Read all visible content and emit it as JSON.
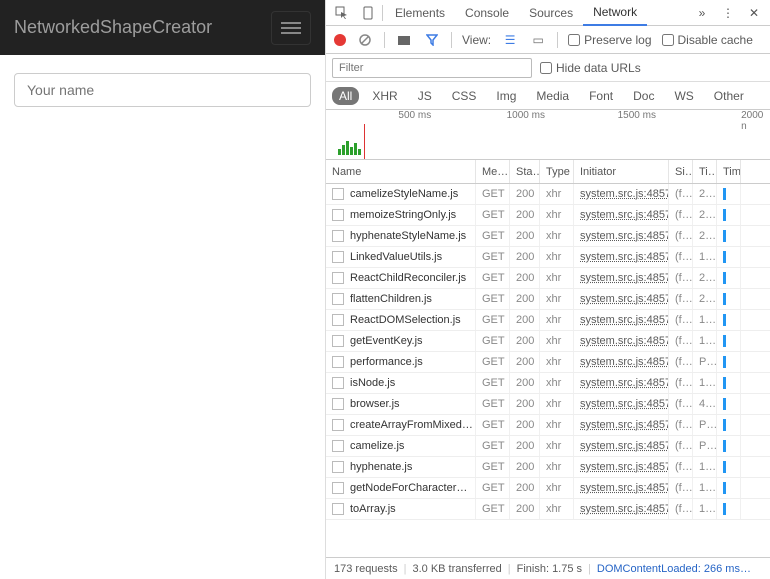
{
  "app": {
    "brand": "NetworkedShapeCreator",
    "name_placeholder": "Your name"
  },
  "devtools": {
    "panels": [
      "Elements",
      "Console",
      "Sources",
      "Network"
    ],
    "active_panel": "Network",
    "toolbar": {
      "view_label": "View:",
      "preserve_log": "Preserve log",
      "disable_cache": "Disable cache"
    },
    "filter": {
      "placeholder": "Filter",
      "hide_data_urls": "Hide data URLs"
    },
    "types": [
      "All",
      "XHR",
      "JS",
      "CSS",
      "Img",
      "Media",
      "Font",
      "Doc",
      "WS",
      "Other"
    ],
    "active_type": "All",
    "timeline_ticks": [
      {
        "label": "500 ms",
        "pos": 20
      },
      {
        "label": "1000 ms",
        "pos": 45
      },
      {
        "label": "1500 ms",
        "pos": 70
      },
      {
        "label": "2000 n",
        "pos": 96
      }
    ],
    "columns": [
      "Name",
      "Me…",
      "Sta…",
      "Type",
      "Initiator",
      "Si…",
      "Ti…",
      "Tim"
    ],
    "rows": [
      {
        "name": "camelizeStyleName.js",
        "method": "GET",
        "status": "200",
        "type": "xhr",
        "initiator": "system.src.js:4857",
        "size": "(f…",
        "time": "2…"
      },
      {
        "name": "memoizeStringOnly.js",
        "method": "GET",
        "status": "200",
        "type": "xhr",
        "initiator": "system.src.js:4857",
        "size": "(f…",
        "time": "2…"
      },
      {
        "name": "hyphenateStyleName.js",
        "method": "GET",
        "status": "200",
        "type": "xhr",
        "initiator": "system.src.js:4857",
        "size": "(f…",
        "time": "2…"
      },
      {
        "name": "LinkedValueUtils.js",
        "method": "GET",
        "status": "200",
        "type": "xhr",
        "initiator": "system.src.js:4857",
        "size": "(f…",
        "time": "1…"
      },
      {
        "name": "ReactChildReconciler.js",
        "method": "GET",
        "status": "200",
        "type": "xhr",
        "initiator": "system.src.js:4857",
        "size": "(f…",
        "time": "2…"
      },
      {
        "name": "flattenChildren.js",
        "method": "GET",
        "status": "200",
        "type": "xhr",
        "initiator": "system.src.js:4857",
        "size": "(f…",
        "time": "2…"
      },
      {
        "name": "ReactDOMSelection.js",
        "method": "GET",
        "status": "200",
        "type": "xhr",
        "initiator": "system.src.js:4857",
        "size": "(f…",
        "time": "1…"
      },
      {
        "name": "getEventKey.js",
        "method": "GET",
        "status": "200",
        "type": "xhr",
        "initiator": "system.src.js:4857",
        "size": "(f…",
        "time": "1…"
      },
      {
        "name": "performance.js",
        "method": "GET",
        "status": "200",
        "type": "xhr",
        "initiator": "system.src.js:4857",
        "size": "(f…",
        "time": "P…"
      },
      {
        "name": "isNode.js",
        "method": "GET",
        "status": "200",
        "type": "xhr",
        "initiator": "system.src.js:4857",
        "size": "(f…",
        "time": "1…"
      },
      {
        "name": "browser.js",
        "method": "GET",
        "status": "200",
        "type": "xhr",
        "initiator": "system.src.js:4857",
        "size": "(f…",
        "time": "4…"
      },
      {
        "name": "createArrayFromMixed…",
        "method": "GET",
        "status": "200",
        "type": "xhr",
        "initiator": "system.src.js:4857",
        "size": "(f…",
        "time": "P…"
      },
      {
        "name": "camelize.js",
        "method": "GET",
        "status": "200",
        "type": "xhr",
        "initiator": "system.src.js:4857",
        "size": "(f…",
        "time": "P…"
      },
      {
        "name": "hyphenate.js",
        "method": "GET",
        "status": "200",
        "type": "xhr",
        "initiator": "system.src.js:4857",
        "size": "(f…",
        "time": "1…"
      },
      {
        "name": "getNodeForCharacter…",
        "method": "GET",
        "status": "200",
        "type": "xhr",
        "initiator": "system.src.js:4857",
        "size": "(f…",
        "time": "1…"
      },
      {
        "name": "toArray.js",
        "method": "GET",
        "status": "200",
        "type": "xhr",
        "initiator": "system.src.js:4857",
        "size": "(f…",
        "time": "1…"
      }
    ],
    "status": {
      "requests": "173 requests",
      "transferred": "3.0 KB transferred",
      "finish": "Finish: 1.75 s",
      "dcl": "DOMContentLoaded: 266 ms…"
    }
  }
}
